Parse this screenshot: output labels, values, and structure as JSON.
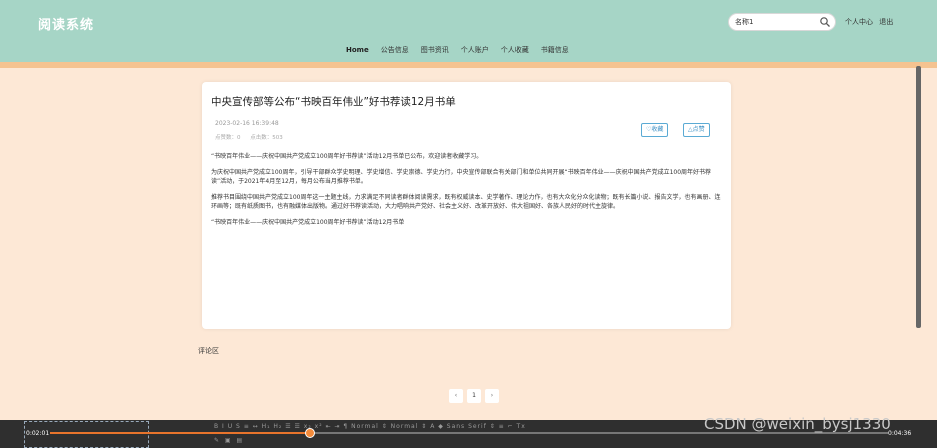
{
  "app": {
    "title": "阅读系统"
  },
  "search": {
    "value": "名称1"
  },
  "user_links": [
    "个人中心",
    "退出"
  ],
  "nav": {
    "items": [
      {
        "label": "Home",
        "active": true
      },
      {
        "label": "公告信息",
        "active": false
      },
      {
        "label": "图书资讯",
        "active": false
      },
      {
        "label": "个人账户",
        "active": false
      },
      {
        "label": "个人收藏",
        "active": false
      },
      {
        "label": "书籍信息",
        "active": false
      }
    ]
  },
  "article": {
    "title": "中央宣传部等公布“书映百年伟业”好书荐读12月书单",
    "date": "2023-02-16 16:39:48",
    "likes_label": "点赞数：0",
    "clicks_label": "点击数：503",
    "fav_button": "♡收藏",
    "like_button": "△点赞",
    "paragraphs": [
      "“书映百年伟业——庆祝中国共产党成立100周年好书荐读”活动12月书单已公布，欢迎读者收藏学习。",
      "为庆祝中国共产党成立100周年，引导干部群众学史明理、学史增信、学史崇德、学史力行，中央宣传部联合有关部门和单位共同开展“书映百年伟业——庆祝中国共产党成立100周年好书荐读”活动，于2021年4月至12月，每月公布当月推荐书单。",
      "推荐书目围绕中国共产党成立100周年这一主题主线，力求满足不同读者群体阅读需求，既有权威读本、史学著作、理论力作，也有大众化分众化读物；既有长篇小说、报告文学，也有画册、连环画等；既有纸质图书，也有融媒体出版物。通过好书荐读活动，大力唱响共产党好、社会主义好、改革开放好、伟大祖国好、各族人民好的时代主旋律。",
      "“书映百年伟业——庆祝中国共产党成立100周年好书荐读”活动12月书单"
    ]
  },
  "comments": {
    "label": "评论区"
  },
  "pagination": {
    "prev": "‹",
    "current": "1",
    "next": "›"
  },
  "player": {
    "time_current": "0:02:01",
    "time_total": "0:04:36",
    "progress": 0.31,
    "toolbar": "B I U S  ≡ ↔  H₁ H₂  ☰ ☰  x₂ x²  ⇤ ⇥  ¶  Normal ⇕  Normal ⇕  A ◆  Sans Serif ⇕  ≡  ⌐  Tx",
    "toolbar2": "✎ ▣ ▤"
  },
  "watermark": "CSDN @weixin_bysj1330",
  "colors": {
    "header_bg": "#a6d5c6",
    "stripe": "#f5c390",
    "page_bg": "#fde8d6",
    "accent_button": "#3b8fc4",
    "progress": "#e8742c"
  }
}
